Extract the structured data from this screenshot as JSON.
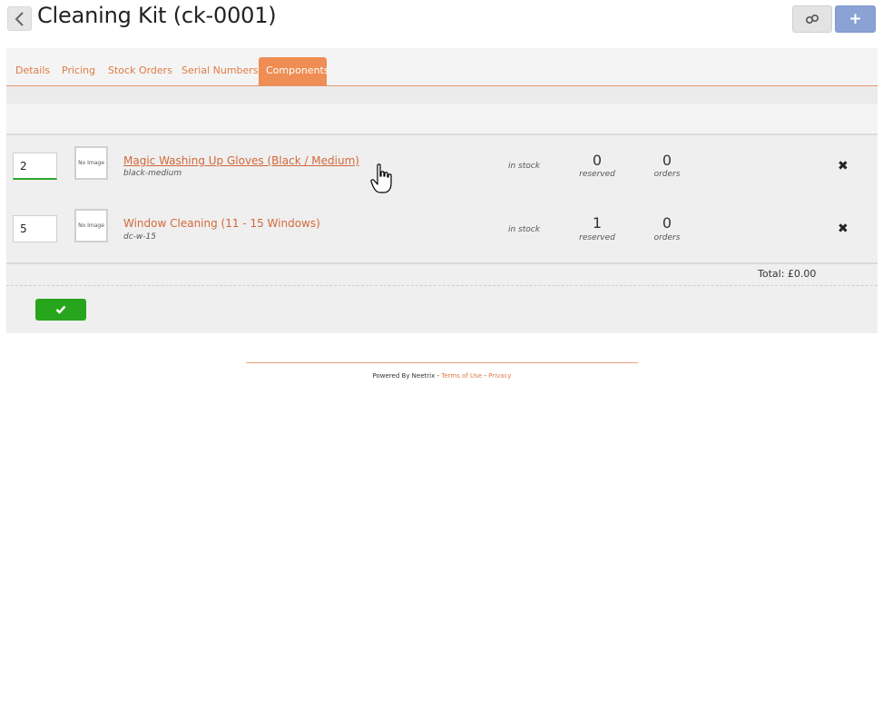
{
  "header": {
    "title": "Cleaning Kit (ck-0001)",
    "back_icon": "chevron-left-icon",
    "link_button_icon": "chain-link-icon",
    "add_button_label": "+"
  },
  "tabs": [
    {
      "label": "Details",
      "active": false
    },
    {
      "label": "Pricing",
      "active": false
    },
    {
      "label": "Stock Orders",
      "active": false
    },
    {
      "label": "Serial Numbers",
      "active": false
    },
    {
      "label": "Components",
      "active": true
    }
  ],
  "components": [
    {
      "quantity": "2",
      "thumbnail_text": "No Image",
      "name": "Magic Washing Up Gloves (Black / Medium)",
      "sku": "black-medium",
      "stock_status": "in stock",
      "reserved": "0",
      "reserved_label": "reserved",
      "orders": "0",
      "orders_label": "orders"
    },
    {
      "quantity": "5",
      "thumbnail_text": "No Image",
      "name": "Window Cleaning (11 - 15 Windows)",
      "sku": "dc-w-15",
      "stock_status": "in stock",
      "reserved": "1",
      "reserved_label": "reserved",
      "orders": "0",
      "orders_label": "orders"
    }
  ],
  "total_text": "Total: £0.00",
  "footer": {
    "powered_by": "Powered By Neetrix",
    "separator1": " - ",
    "terms_label": "Terms of Use",
    "separator2": " - ",
    "privacy_label": "Privacy"
  },
  "colors": {
    "accent": "#ee8d54",
    "link": "#d2683a",
    "save_green": "#27a51c",
    "add_blue": "#8aa2d4"
  }
}
